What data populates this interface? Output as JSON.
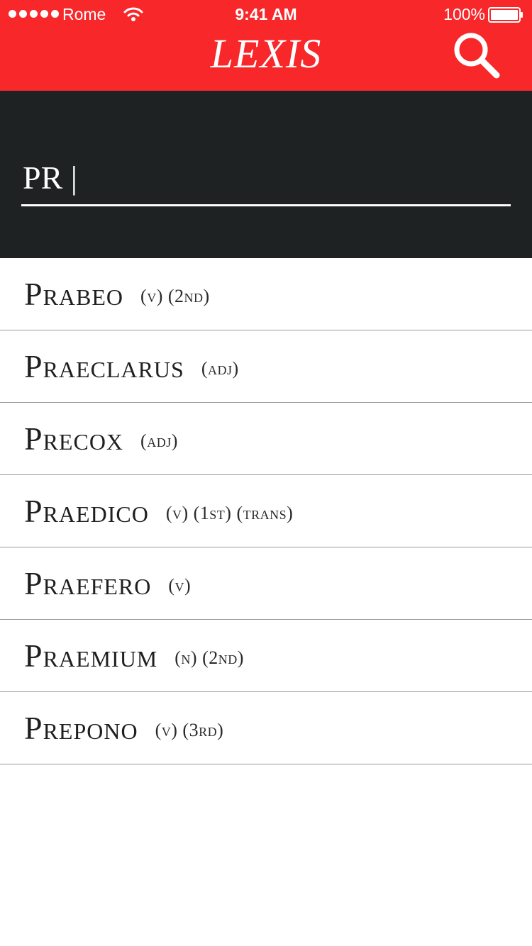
{
  "status_bar": {
    "carrier": "Rome",
    "time": "9:41 AM",
    "battery": "100%"
  },
  "header": {
    "title": "LEXIS",
    "background": "#f7272a",
    "search_icon": "search-icon"
  },
  "search": {
    "value": "PR |",
    "background": "#1e2223"
  },
  "results": [
    {
      "word": "Prabeo",
      "grammar": "(v) (2nd)"
    },
    {
      "word": "Praeclarus",
      "grammar": "(adj)"
    },
    {
      "word": "Precox",
      "grammar": "(adj)"
    },
    {
      "word": "Praedico",
      "grammar": "(v) (1st) (trans)"
    },
    {
      "word": "Praefero",
      "grammar": "(v)"
    },
    {
      "word": "Praemium",
      "grammar": "(n) (2nd)"
    },
    {
      "word": "Prepono",
      "grammar": "(v) (3rd)"
    }
  ]
}
